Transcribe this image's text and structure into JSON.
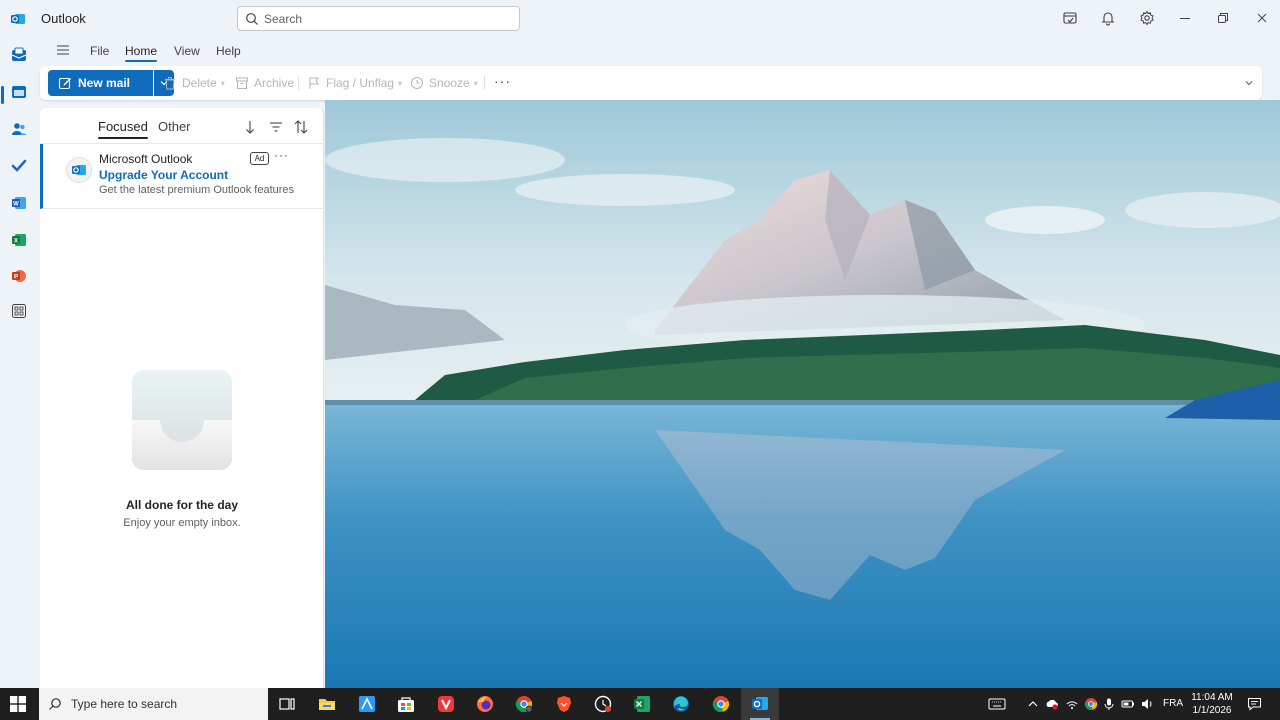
{
  "app": {
    "title": "Outlook"
  },
  "search": {
    "placeholder": "Search"
  },
  "menu": {
    "tabs": [
      "File",
      "Home",
      "View",
      "Help"
    ],
    "active": "Home"
  },
  "toolbar": {
    "new_mail": "New mail",
    "delete": "Delete",
    "archive": "Archive",
    "flag": "Flag / Unflag",
    "snooze": "Snooze",
    "more": "···"
  },
  "maillist": {
    "tabs": {
      "focused": "Focused",
      "other": "Other"
    },
    "messages": [
      {
        "sender": "Microsoft Outlook",
        "subject": "Upgrade Your Account",
        "preview": "Get the latest premium Outlook features",
        "badge": "Ad",
        "more": "···"
      }
    ],
    "empty": {
      "title": "All done for the day",
      "subtitle": "Enjoy your empty inbox."
    }
  },
  "taskbar": {
    "search_placeholder": "Type here to search",
    "language": "FRA",
    "time": "11:04 AM",
    "date": "1/1/2026"
  },
  "icons": {
    "rail": [
      "mail-icon",
      "calendar-icon",
      "people-icon",
      "todo-icon",
      "word-icon",
      "excel-icon",
      "powerpoint-icon",
      "apps-icon"
    ],
    "taskbar_apps": [
      "task-view-icon",
      "file-explorer-icon",
      "photoshop-icon",
      "microsoft-store-icon",
      "vivaldi-icon",
      "firefox-icon",
      "chrome-profile-icon",
      "brave-icon",
      "chrome-app-icon",
      "excel-icon",
      "edge-icon",
      "chrome-icon",
      "outlook-icon"
    ]
  },
  "colors": {
    "accent": "#0f6cbd",
    "taskbar": "#1f1f1f",
    "chrome": "#eef3f8"
  }
}
